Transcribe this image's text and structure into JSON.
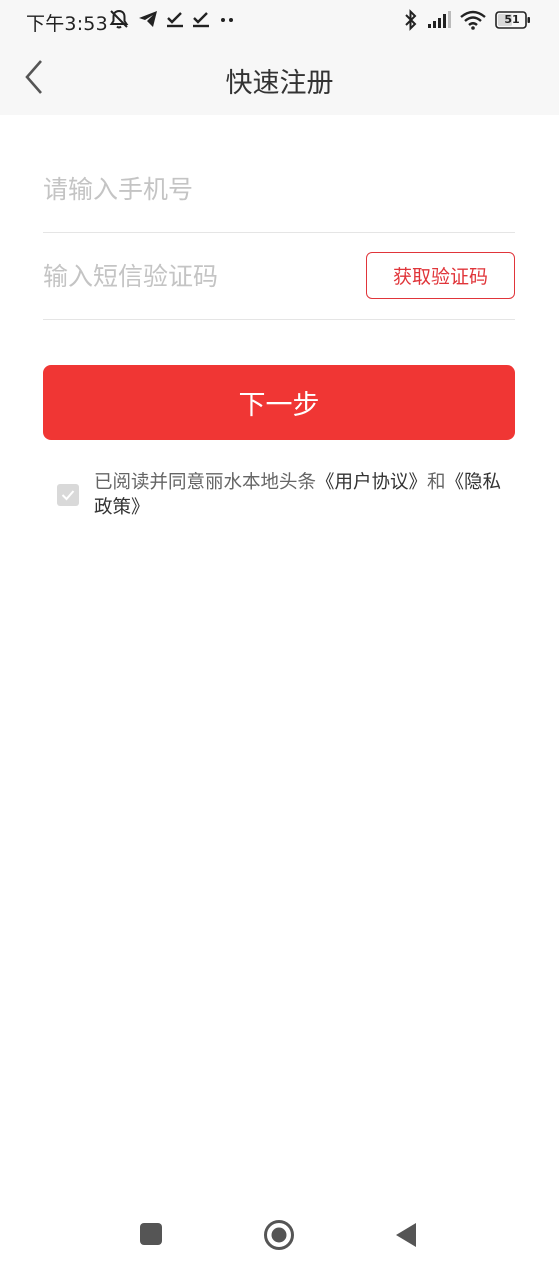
{
  "status_bar": {
    "time": "下午3:53",
    "left_icons": [
      "mute-bell-icon",
      "telegram-icon",
      "check-icon",
      "check-icon",
      "more-dots-icon"
    ],
    "right_icons": [
      "bluetooth-icon",
      "signal-icon",
      "wifi-icon",
      "battery-icon"
    ],
    "battery_level": "51"
  },
  "nav": {
    "title": "快速注册",
    "back_icon": "chevron-left-icon"
  },
  "form": {
    "phone_placeholder": "请输入手机号",
    "phone_value": "",
    "code_placeholder": "输入短信验证码",
    "code_value": "",
    "get_code_label": "获取验证码"
  },
  "next_label": "下一步",
  "agreement": {
    "prefix": "已阅读并同意丽水本地头条",
    "user_agreement": "《用户协议》",
    "and": "和",
    "privacy_policy": "《隐私政策》",
    "checked": true
  },
  "colors": {
    "accent": "#f03634",
    "accent_border": "#e0353a",
    "header_bg": "#f7f7f7"
  },
  "system_nav": [
    "recent-apps-icon",
    "home-icon",
    "back-triangle-icon"
  ]
}
